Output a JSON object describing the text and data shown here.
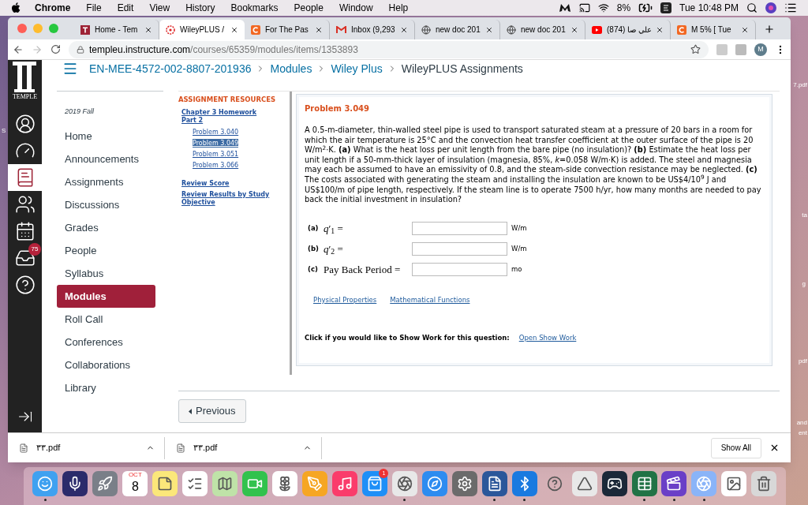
{
  "menubar": {
    "app": "Chrome",
    "menus": [
      "File",
      "Edit",
      "View",
      "History",
      "Bookmarks",
      "People",
      "Window",
      "Help"
    ],
    "battery": "8%",
    "clock": "Tue 10:48 PM"
  },
  "tabs": [
    {
      "title": "Home - Tem",
      "kind": "square",
      "selected": false
    },
    {
      "title": "WileyPLUS /",
      "kind": "asterisk",
      "selected": true
    },
    {
      "title": "For The Pas",
      "kind": "arc",
      "selected": false
    },
    {
      "title": "Inbox (9,293",
      "kind": "mail",
      "selected": false
    },
    {
      "title": "new doc 201",
      "kind": "globe",
      "selected": false
    },
    {
      "title": "new doc 201",
      "kind": "globe",
      "selected": false
    },
    {
      "title": "(874) علي صا",
      "kind": "video",
      "selected": false
    },
    {
      "title": "M 5% [ Tue",
      "kind": "arc",
      "selected": false
    }
  ],
  "address": {
    "host": "templeu.instructure.com",
    "path": "/courses/65359/modules/items/1353893"
  },
  "profile_initial": "M",
  "logo_text": "TEMPLE",
  "global_nav": [
    {
      "kind": "account",
      "selected": false
    },
    {
      "kind": "dashboard",
      "selected": false
    },
    {
      "kind": "courses",
      "selected": true
    },
    {
      "kind": "groups",
      "selected": false
    },
    {
      "kind": "calendar",
      "selected": false
    },
    {
      "kind": "inbox",
      "selected": false,
      "badge": "75"
    },
    {
      "kind": "help",
      "selected": false
    }
  ],
  "breadcrumb": [
    "EN-MEE-4572-002-8807-201936",
    "Modules",
    "Wiley Plus",
    "WileyPLUS Assignments"
  ],
  "course_nav": {
    "term": "2019 Fall",
    "items": [
      {
        "label": "Home",
        "selected": false
      },
      {
        "label": "Announcements",
        "selected": false
      },
      {
        "label": "Assignments",
        "selected": false
      },
      {
        "label": "Discussions",
        "selected": false
      },
      {
        "label": "Grades",
        "selected": false
      },
      {
        "label": "People",
        "selected": false
      },
      {
        "label": "Syllabus",
        "selected": false
      },
      {
        "label": "Modules",
        "selected": true
      },
      {
        "label": "Roll Call",
        "selected": false
      },
      {
        "label": "Conferences",
        "selected": false
      },
      {
        "label": "Collaborations",
        "selected": false
      },
      {
        "label": "Library",
        "selected": false
      }
    ]
  },
  "resources": {
    "heading": "ASSIGNMENT RESOURCES",
    "chapter": "Chapter 3 Homework Part 2",
    "problems": [
      {
        "label": "Problem 3.040",
        "selected": false
      },
      {
        "label": "Problem 3.049",
        "selected": true
      },
      {
        "label": "Problem 3.051",
        "selected": false
      },
      {
        "label": "Problem 3.066",
        "selected": false
      }
    ],
    "links": [
      "Review Score",
      "Review Results by Study Objective"
    ]
  },
  "problem": {
    "title": "Problem 3.049",
    "text": "A 0.5-m-diameter, thin-walled steel pipe is used to transport saturated steam at a pressure of 20 bars in a room for which the air temperature is 25°C and the convection heat transfer coefficient at the outer surface of the pipe is 20 W/m$^{2}$·K. **(a)** What is the heat loss per unit length from the bare pipe (no insulation)? **(b)** Estimate the heat loss per unit length if a 50-mm-thick layer of insulation (magnesia, 85%, *k*=0.058 W/m·K) is added. The steel and magnesia may each be assumed to have an emissivity of 0.8, and the steam-side convection resistance may be neglected. **(c)** The costs associated with generating the steam and installing the insulation are known to be US$4/10$^{9}$ J and US$100/m of pipe length, respectively. If the steam line is to operate 7500 h/yr, how many months are needed to pay back the initial investment in insulation?",
    "answers": [
      {
        "label": "(a)",
        "quantity": "*q*′$_{1}$ =",
        "unit": "W/m"
      },
      {
        "label": "(b)",
        "quantity": "*q*′$_{2}$ =",
        "unit": "W/m"
      },
      {
        "label": "(c)",
        "quantity": "Pay Back Period =",
        "unit": "mo"
      }
    ],
    "tool_links": [
      "Physical Properties",
      "Mathematical Functions"
    ],
    "show_work": {
      "prompt": "Click if you would like to Show Work for this question:",
      "link": "Open Show Work"
    }
  },
  "previous": "Previous",
  "downloads": {
    "items": [
      "٣٣.pdf",
      "٣٣.pdf"
    ],
    "show_all": "Show All"
  },
  "desktop_labels": [
    "S",
    "7.pdf",
    "ta",
    "g",
    "pdf",
    "and",
    "ent"
  ],
  "dock": [
    {
      "kind": "finder",
      "running": true
    },
    {
      "kind": "siri",
      "running": false
    },
    {
      "kind": "launchpad",
      "running": false
    },
    {
      "kind": "calendar",
      "running": false,
      "month": "OCT",
      "day": "8"
    },
    {
      "kind": "notes",
      "running": false
    },
    {
      "kind": "reminders",
      "running": false
    },
    {
      "kind": "maps",
      "running": false
    },
    {
      "kind": "facetime",
      "running": false
    },
    {
      "kind": "photos",
      "running": false
    },
    {
      "kind": "pages",
      "running": false
    },
    {
      "kind": "music",
      "running": false
    },
    {
      "kind": "appstore",
      "running": false,
      "badge": "1"
    },
    {
      "kind": "chrome",
      "running": true
    },
    {
      "kind": "safari",
      "running": false
    },
    {
      "kind": "settings",
      "running": false
    },
    {
      "kind": "word",
      "running": true
    },
    {
      "kind": "bluetooth",
      "running": true
    },
    {
      "kind": "unknown",
      "running": false
    },
    {
      "kind": "autocad",
      "running": false
    },
    {
      "kind": "steam",
      "running": false
    },
    {
      "kind": "excel",
      "running": true
    },
    {
      "kind": "imovie",
      "running": true
    },
    {
      "kind": "chrome2",
      "running": true
    },
    {
      "kind": "preview",
      "running": false
    },
    {
      "kind": "trash",
      "running": false
    }
  ]
}
